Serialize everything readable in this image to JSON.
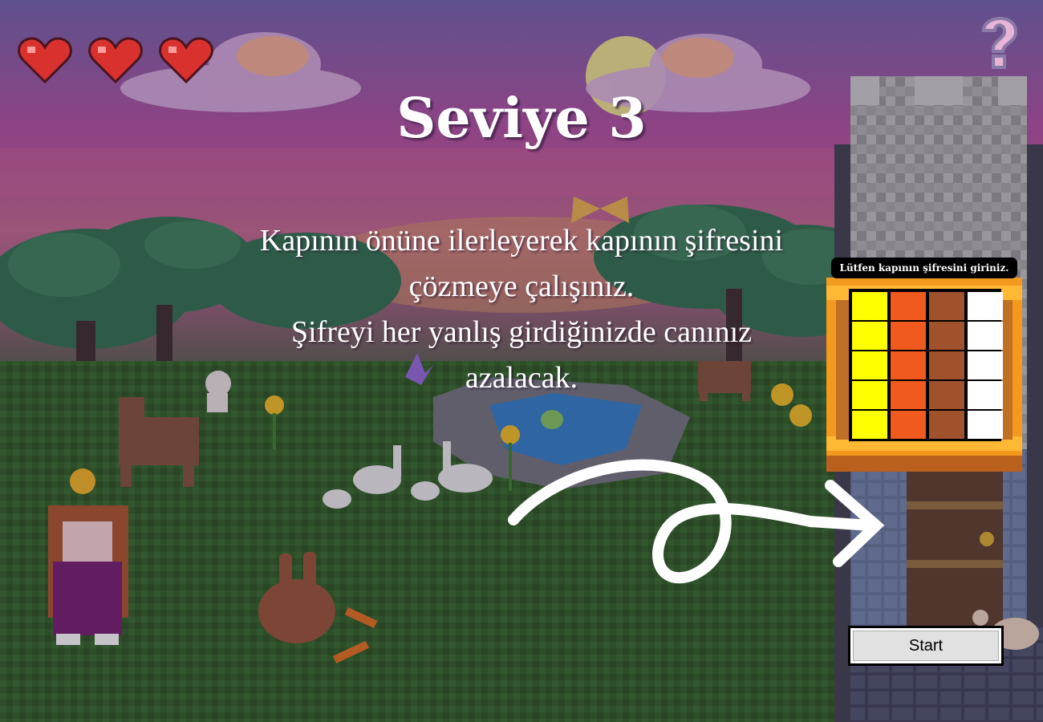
{
  "level_title": "Seviye 3",
  "instructions": [
    "Kapının önüne ilerleyerek kapının şifresini",
    "çözmeye çalışınız.",
    "Şifreyi her yanlış girdiğinizde canınız",
    "azalacak."
  ],
  "lives": {
    "count": 3,
    "heart_color": "#d9322e"
  },
  "help_icon": "question-mark-icon",
  "lock_panel": {
    "label": "Lütfen kapının şifresini giriniz.",
    "columns": [
      "#ffff00",
      "#f05a1e",
      "#a0522d",
      "#ffffff"
    ],
    "rows": 5
  },
  "start_button": {
    "label": "Start"
  },
  "colors": {
    "sky_top": "#6e5ca0",
    "sky_pink": "#b8508e",
    "grass": "#2f5d22",
    "arrow": "#ffffff"
  }
}
